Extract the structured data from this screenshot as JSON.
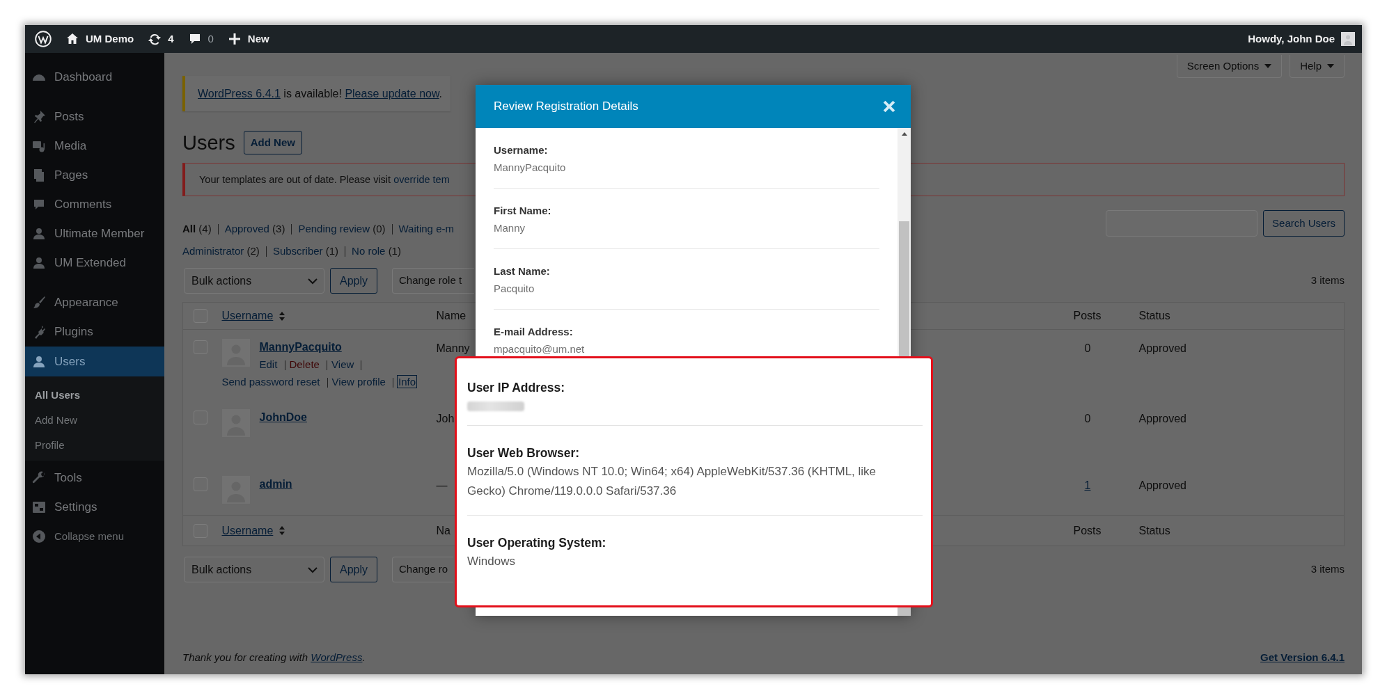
{
  "admin_bar": {
    "site": "UM Demo",
    "updates": "4",
    "comments": "0",
    "new": "New",
    "greeting": "Howdy, John Doe"
  },
  "sidebar": {
    "groups": [
      {
        "items": [
          {
            "label": "Dashboard",
            "kind": "menu",
            "selected": false
          }
        ]
      },
      {
        "items": [
          {
            "label": "Posts",
            "kind": "menu",
            "selected": false
          },
          {
            "label": "Media",
            "kind": "menu",
            "selected": false
          },
          {
            "label": "Pages",
            "kind": "menu",
            "selected": false
          },
          {
            "label": "Comments",
            "kind": "menu",
            "selected": false
          },
          {
            "label": "Ultimate Member",
            "kind": "menu",
            "selected": false
          },
          {
            "label": "UM Extended",
            "kind": "menu",
            "selected": false
          }
        ]
      },
      {
        "items": [
          {
            "label": "Appearance",
            "kind": "menu",
            "selected": false
          },
          {
            "label": "Plugins",
            "kind": "menu",
            "selected": false
          },
          {
            "label": "Users",
            "kind": "menu",
            "selected": true,
            "children": [
              {
                "label": "All Users",
                "selected": true
              },
              {
                "label": "Add New",
                "selected": false
              },
              {
                "label": "Profile",
                "selected": false
              }
            ]
          },
          {
            "label": "Tools",
            "kind": "menu",
            "selected": false
          },
          {
            "label": "Settings",
            "kind": "menu",
            "selected": false
          },
          {
            "label": "Collapse menu",
            "kind": "collapse",
            "selected": false
          }
        ]
      }
    ]
  },
  "screen_tabs": [
    {
      "label": "Screen Options"
    },
    {
      "label": "Help"
    }
  ],
  "update_notice": {
    "link": "WordPress 6.4.1",
    "text": " is available! ",
    "action": "Please update now",
    "end": "."
  },
  "page_title": "Users",
  "add_new": "Add New",
  "template_notice": {
    "text": "Your templates are out of date. Please visit ",
    "link": "override tem"
  },
  "status_filters": [
    {
      "label": "All",
      "count": "(4)",
      "selected": true
    },
    {
      "label": "Approved",
      "count": "(3)",
      "selected": false
    },
    {
      "label": "Pending review",
      "count": "(0)",
      "selected": false
    },
    {
      "label": "Waiting e-m",
      "selected": false
    }
  ],
  "role_filters": [
    {
      "label": "Administrator",
      "count": "(2)",
      "selected": false
    },
    {
      "label": "Subscriber",
      "count": "(1)",
      "selected": false
    },
    {
      "label": "No role",
      "count": "(1)",
      "selected": false
    }
  ],
  "search": {
    "button": "Search Users"
  },
  "top_actions": {
    "bulk": "Bulk actions",
    "apply": "Apply",
    "change_role": "Change role t",
    "count": "3 items"
  },
  "table": {
    "select_all_checked": false,
    "columns": [
      {
        "label": "Username",
        "sortable": true
      },
      {
        "label": "Name",
        "sortable": false
      },
      {
        "label": "Posts",
        "sortable": false
      },
      {
        "label": "Status",
        "sortable": false
      }
    ],
    "rows": [
      {
        "checked": false,
        "username": "MannyPacquito",
        "name": "Manny",
        "posts": "0",
        "posts_link": false,
        "status": "Approved",
        "actions": [
          {
            "label": "Edit",
            "kind": "link",
            "focused": false
          },
          {
            "label": "Delete",
            "kind": "delete",
            "focused": false
          },
          {
            "label": "View",
            "kind": "link",
            "focused": false
          },
          {
            "label": "Send password reset",
            "kind": "link",
            "focused": false
          },
          {
            "label": "View profile",
            "kind": "link",
            "focused": false
          },
          {
            "label": "Info",
            "kind": "link",
            "focused": true
          }
        ]
      },
      {
        "checked": false,
        "username": "JohnDoe",
        "name": "Joh",
        "posts": "0",
        "posts_link": false,
        "status": "Approved"
      },
      {
        "checked": false,
        "username": "admin",
        "name": "—",
        "posts": "1",
        "posts_link": true,
        "status": "Approved"
      }
    ],
    "footer_select_all_checked": false,
    "footer_columns": [
      {
        "label": "Username",
        "sortable": true
      },
      {
        "label": "Na",
        "sortable": false
      },
      {
        "label": "Posts",
        "sortable": false
      },
      {
        "label": "Status",
        "sortable": false
      }
    ]
  },
  "bottom_actions": {
    "bulk": "Bulk actions",
    "apply": "Apply",
    "change_role": "Change ro",
    "count": "3 items"
  },
  "footer": {
    "text": "Thank you for creating with ",
    "link": "WordPress",
    "end": ".",
    "version": "Get Version 6.4.1"
  },
  "modal": {
    "title": "Review Registration Details",
    "fields": [
      {
        "label": "Username:",
        "value": "MannyPacquito"
      },
      {
        "label": "First Name:",
        "value": "Manny"
      },
      {
        "label": "Last Name:",
        "value": "Pacquito"
      },
      {
        "label": "E-mail Address:",
        "value": "mpacquito@um.net"
      }
    ]
  },
  "callout": {
    "fields": [
      {
        "label": "User IP Address:",
        "kind": "blurred"
      },
      {
        "label": "User Web Browser:",
        "kind": "text",
        "value": "Mozilla/5.0 (Windows NT 10.0; Win64; x64) AppleWebKit/537.36 (KHTML, like Gecko) Chrome/119.0.0.0 Safari/537.36"
      },
      {
        "label": "User Operating System:",
        "kind": "text",
        "value": "Windows"
      }
    ]
  }
}
